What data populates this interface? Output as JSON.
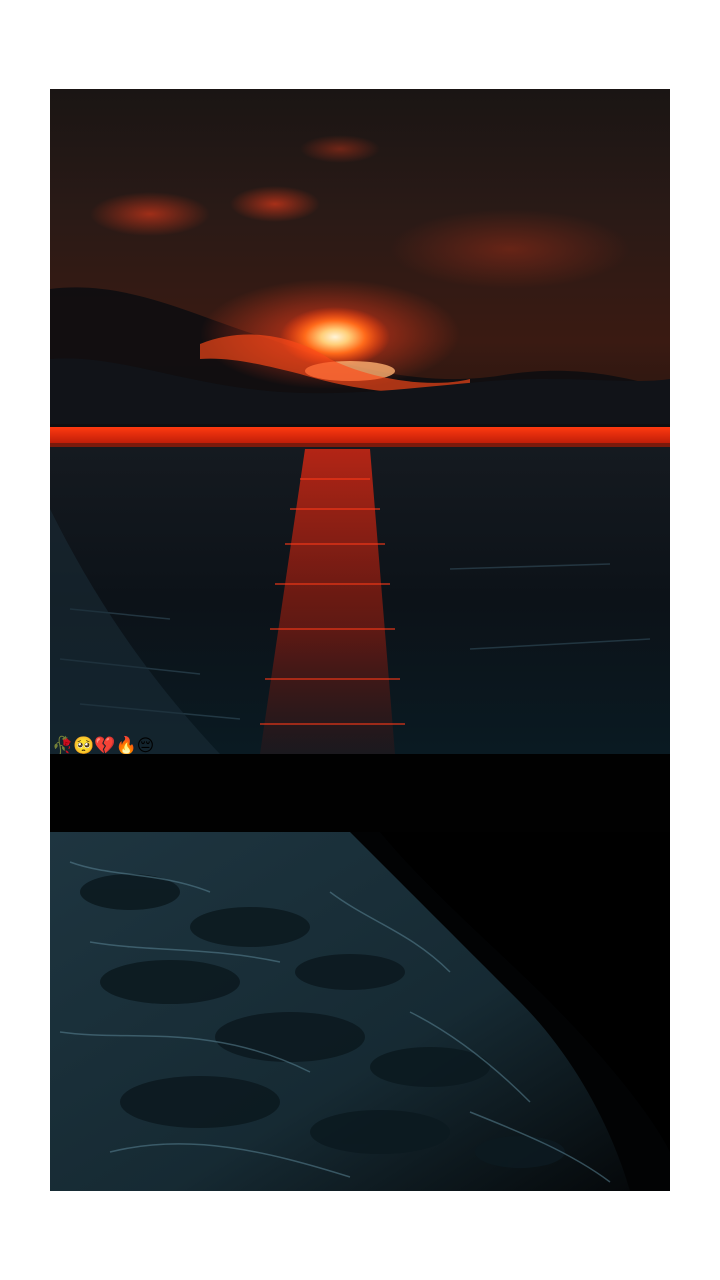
{
  "video": {
    "caption_emojis": "🥀🥺💔🔥😔"
  },
  "colors": {
    "page_background": "#ffffff",
    "sky_dark": "#1c1414",
    "sunset_red": "#e0200a",
    "sun_glow": "#ffd9a0",
    "sea_dark": "#0a0f14",
    "foam": "#2e4a55"
  }
}
